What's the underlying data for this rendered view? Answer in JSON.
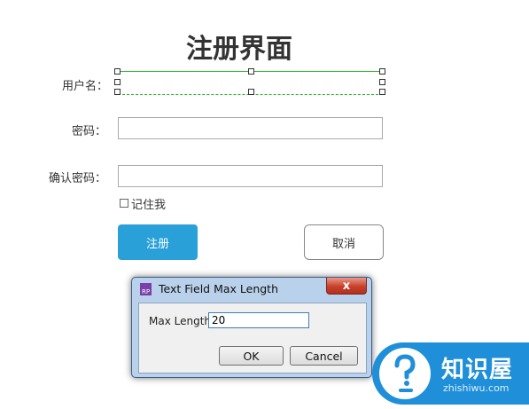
{
  "form": {
    "title": "注册界面",
    "username_label": "用户名：",
    "password_label": "密码：",
    "confirm_password_label": "确认密码：",
    "remember_label": "记住我",
    "register_button": "注册",
    "cancel_button": "取消"
  },
  "dialog": {
    "title": "Text Field Max Length",
    "app_icon_text": "RP",
    "close_glyph": "x",
    "max_length_label": "Max Length",
    "max_length_value": "20",
    "ok_label": "OK",
    "cancel_label": "Cancel"
  },
  "watermark": {
    "brand": "知识屋",
    "url": "zhishiwu.com"
  },
  "colors": {
    "primary_button": "#2aa0d8",
    "selection_green": "#2db62d",
    "logo_blue": "#1e8fd8"
  }
}
